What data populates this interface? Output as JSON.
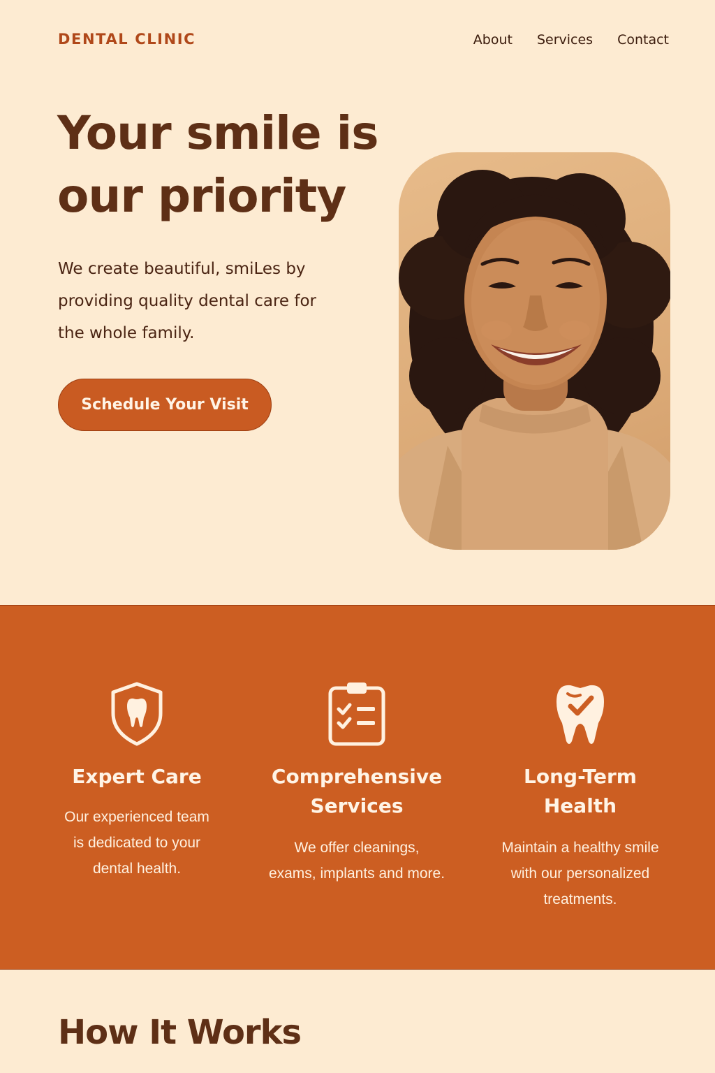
{
  "header": {
    "brand": "DENTAL CLINIC",
    "nav": [
      "About",
      "Services",
      "Contact"
    ]
  },
  "hero": {
    "title_line1": "Your smile is",
    "title_line2": "our priority",
    "description_line1": "We create beautiful, smiLes by",
    "description_line2": "providing quality dental care for",
    "description_line3": "the whole family.",
    "cta_label": "Schedule Your Visit"
  },
  "features": [
    {
      "icon": "shield-tooth-icon",
      "title_lines": [
        "Expert Care"
      ],
      "text_lines": [
        "Our experienced team",
        "is dedicated to your",
        "dental health."
      ]
    },
    {
      "icon": "clipboard-checklist-icon",
      "title_lines": [
        "Comprehensive",
        "Services"
      ],
      "text_lines": [
        "We offer cleanings,",
        "exams, implants and more."
      ]
    },
    {
      "icon": "tooth-check-icon",
      "title_lines": [
        "Long-Term",
        "Health"
      ],
      "text_lines": [
        "Maintain a healthy smile",
        "with our personalized",
        "treatments."
      ]
    }
  ],
  "how_it_works": {
    "title": "How It Works"
  },
  "colors": {
    "background": "#fdebd2",
    "accent": "#cc5e22",
    "heading": "#5e2f16",
    "brand": "#b0481a",
    "light_text": "#fff4e6"
  }
}
